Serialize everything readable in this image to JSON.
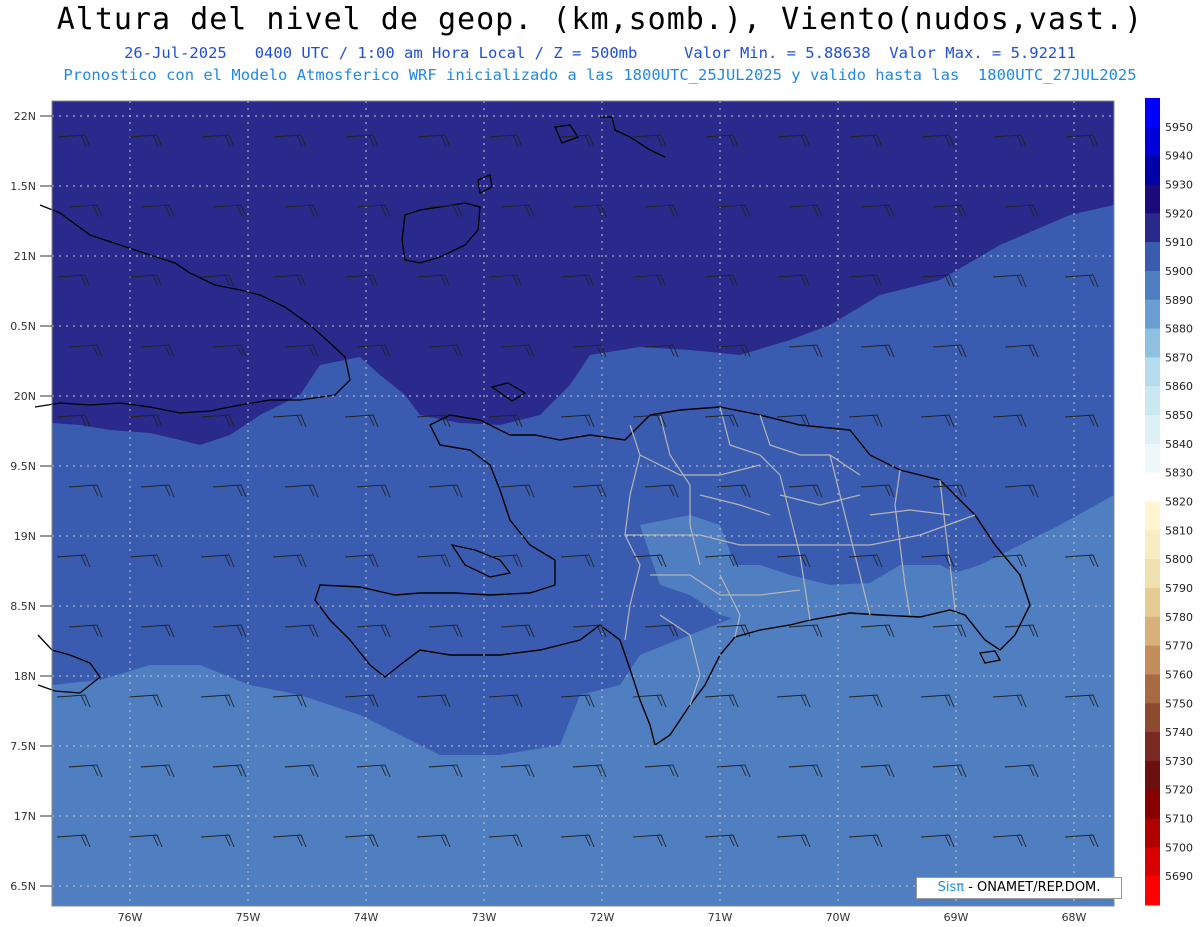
{
  "header": {
    "title": "Altura del nivel de geop. (km,somb.), Viento(nudos,vast.)",
    "subtitle_line1": "26-Jul-2025   0400 UTC / 1:00 am Hora Local / Z = 500mb     Valor Min. = 5.88638  Valor Max. = 5.92211",
    "subtitle_line2": "Pronostico con el Modelo Atmosferico WRF inicializado a las 1800UTC_25JUL2025 y valido hasta las  1800UTC_27JUL2025"
  },
  "map": {
    "lon_labels": [
      "76W",
      "75W",
      "74W",
      "73W",
      "72W",
      "71W",
      "70W",
      "69W",
      "68W"
    ],
    "lat_labels": [
      "22N",
      "1.5N",
      "21N",
      "0.5N",
      "20N",
      "9.5N",
      "19N",
      "8.5N",
      "18N",
      "7.5N",
      "17N",
      "6.5N"
    ],
    "colors": {
      "ocean_dark": "#2a2a8c",
      "mid": "#3a5cb0",
      "light": "#4f7fc0",
      "coast": "#000000",
      "provinces": "#b4b4b4"
    }
  },
  "colorbar": {
    "levels": [
      "5950",
      "5940",
      "5930",
      "5920",
      "5910",
      "5900",
      "5890",
      "5880",
      "5870",
      "5860",
      "5850",
      "5840",
      "5830",
      "5820",
      "5810",
      "5800",
      "5790",
      "5780",
      "5770",
      "5760",
      "5750",
      "5740",
      "5730",
      "5720",
      "5710",
      "5700",
      "5690"
    ],
    "colors": [
      "#0000ff",
      "#0000d8",
      "#0000a8",
      "#1a0a7a",
      "#2a2a8c",
      "#3a5cb0",
      "#4f7fc0",
      "#6a9ed2",
      "#8ec0e2",
      "#b5dcee",
      "#cbe8f2",
      "#ddf0f6",
      "#eef8fb",
      "#ffffff",
      "#fff6d0",
      "#f7ecc2",
      "#f1e0b0",
      "#e6cb94",
      "#d8b07a",
      "#c48e5c",
      "#a86a42",
      "#8c4a30",
      "#7a2a22",
      "#6a1010",
      "#880000",
      "#b00000",
      "#d80000",
      "#ff0000"
    ]
  },
  "credit": {
    "brand": "Sisπ",
    "org": "- ONAMET/REP.DOM."
  }
}
